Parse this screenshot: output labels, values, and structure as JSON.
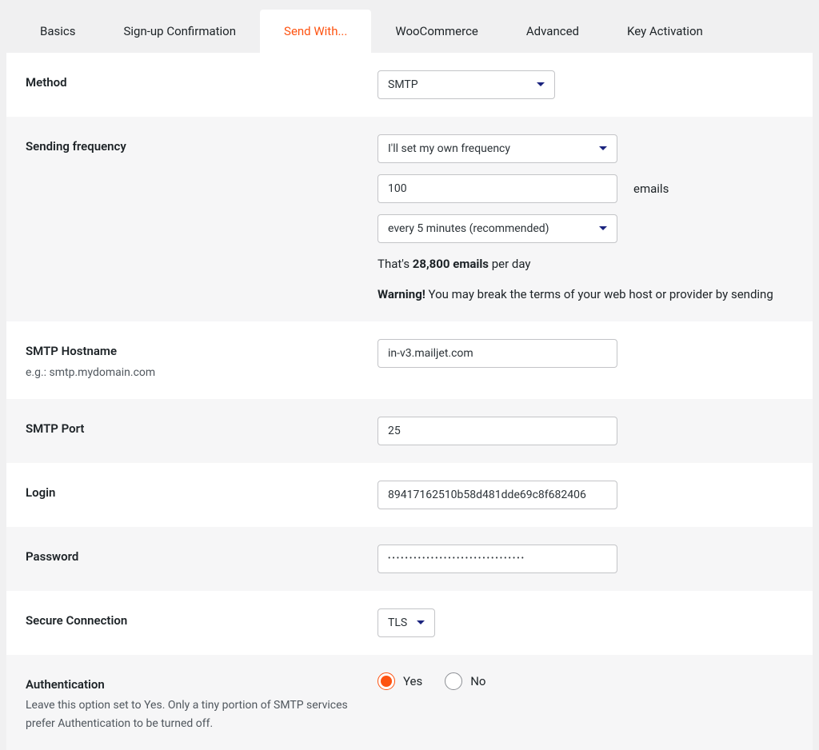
{
  "tabs": {
    "basics": "Basics",
    "signup": "Sign-up Confirmation",
    "sendwith": "Send With...",
    "woo": "WooCommerce",
    "advanced": "Advanced",
    "key": "Key Activation"
  },
  "method": {
    "label": "Method",
    "value": "SMTP"
  },
  "frequency": {
    "label": "Sending frequency",
    "mode": "I'll set my own frequency",
    "count": "100",
    "count_unit": "emails",
    "interval": "every 5 minutes (recommended)",
    "note_prefix": "That's ",
    "note_bold": "28,800 emails",
    "note_suffix": " per day",
    "warning_bold": "Warning!",
    "warning_text": " You may break the terms of your web host or provider by sending"
  },
  "hostname": {
    "label": "SMTP Hostname",
    "hint": "e.g.: smtp.mydomain.com",
    "value": "in-v3.mailjet.com"
  },
  "port": {
    "label": "SMTP Port",
    "value": "25"
  },
  "login": {
    "label": "Login",
    "value": "89417162510b58d481dde69c8f682406"
  },
  "password": {
    "label": "Password",
    "value": "••••••••••••••••••••••••••••••••"
  },
  "secure": {
    "label": "Secure Connection",
    "value": "TLS"
  },
  "auth": {
    "label": "Authentication",
    "hint": "Leave this option set to Yes. Only a tiny portion of SMTP services prefer Authentication to be turned off.",
    "yes": "Yes",
    "no": "No"
  }
}
